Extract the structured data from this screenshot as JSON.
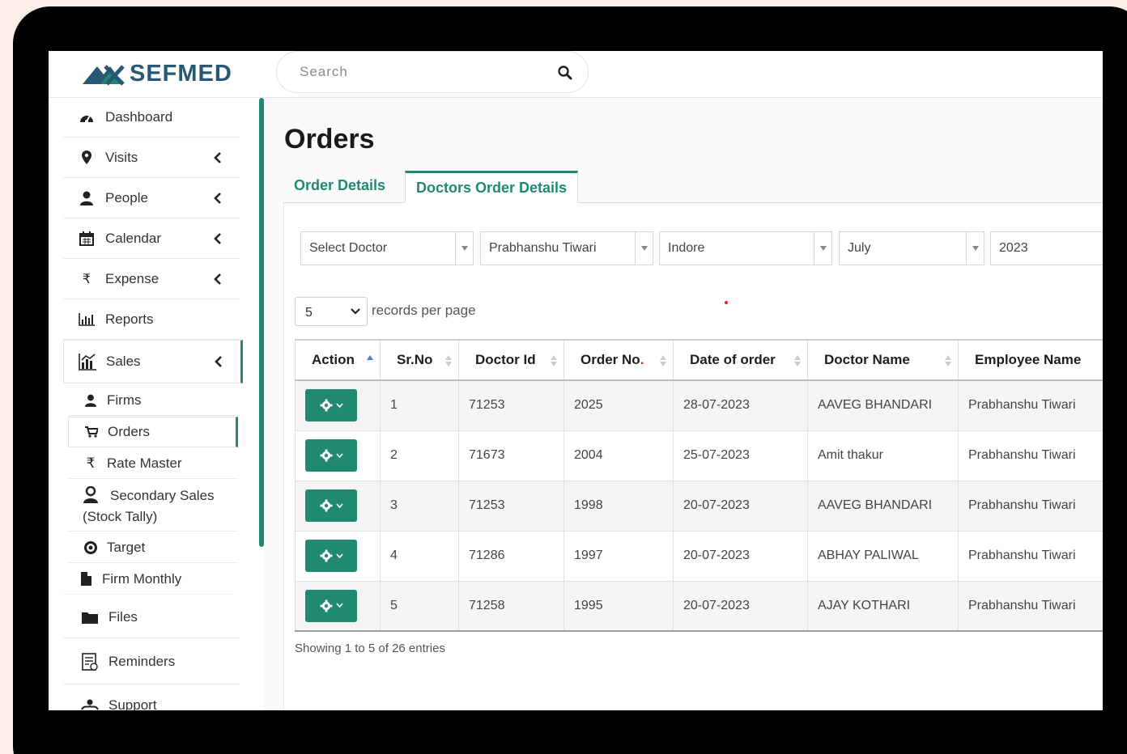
{
  "brand": {
    "name": "SEFMED",
    "accent": "#1f8a70",
    "logo_color": "#2a5874"
  },
  "search": {
    "placeholder": "Search"
  },
  "sidebar": {
    "items": [
      {
        "label": "Dashboard",
        "icon": "dashboard-icon",
        "expandable": false
      },
      {
        "label": "Visits",
        "icon": "map-marker-icon",
        "expandable": true
      },
      {
        "label": "People",
        "icon": "user-icon",
        "expandable": true
      },
      {
        "label": "Calendar",
        "icon": "calendar-icon",
        "expandable": true
      },
      {
        "label": "Expense",
        "icon": "rupee-icon",
        "expandable": true
      },
      {
        "label": "Reports",
        "icon": "bar-chart-icon",
        "expandable": false
      },
      {
        "label": "Sales",
        "icon": "sales-chart-icon",
        "expandable": true
      }
    ],
    "sales_sub": [
      {
        "label": "Firms",
        "icon": "user-icon"
      },
      {
        "label": "Orders",
        "icon": "cart-icon"
      },
      {
        "label": "Rate Master",
        "icon": "rupee-icon"
      },
      {
        "label": "Secondary Sales",
        "label2": "(Stock Tally)",
        "icon": "people-icon"
      },
      {
        "label": "Target",
        "icon": "target-icon"
      },
      {
        "label": "Firm Monthly",
        "icon": "file-icon"
      }
    ],
    "bottom": [
      {
        "label": "Files",
        "icon": "folder-icon"
      },
      {
        "label": "Reminders",
        "icon": "reminder-icon"
      },
      {
        "label": "Support",
        "icon": "support-icon"
      }
    ]
  },
  "page": {
    "title": "Orders",
    "tabs": [
      {
        "label": "Order Details",
        "active": false
      },
      {
        "label": "Doctors Order Details",
        "active": true
      }
    ]
  },
  "filters": {
    "doctor": "Select Doctor",
    "employee": "Prabhanshu Tiwari",
    "city": "Indore",
    "month": "July",
    "year": "2023"
  },
  "records_per_page": {
    "value": "5",
    "label": "records per page"
  },
  "table": {
    "columns": [
      "Action",
      "Sr.No",
      "Doctor Id",
      "Order No",
      "Date of order",
      "Doctor Name",
      "Employee Name"
    ],
    "rows": [
      {
        "sr": "1",
        "doctor_id": "71253",
        "order_no": "2025",
        "date": "28-07-2023",
        "doctor": "AAVEG BHANDARI",
        "employee": "Prabhanshu Tiwari"
      },
      {
        "sr": "2",
        "doctor_id": "71673",
        "order_no": "2004",
        "date": "25-07-2023",
        "doctor": "Amit thakur",
        "employee": "Prabhanshu Tiwari"
      },
      {
        "sr": "3",
        "doctor_id": "71253",
        "order_no": "1998",
        "date": "20-07-2023",
        "doctor": "AAVEG BHANDARI",
        "employee": "Prabhanshu Tiwari"
      },
      {
        "sr": "4",
        "doctor_id": "71286",
        "order_no": "1997",
        "date": "20-07-2023",
        "doctor": "ABHAY PALIWAL",
        "employee": "Prabhanshu Tiwari"
      },
      {
        "sr": "5",
        "doctor_id": "71258",
        "order_no": "1995",
        "date": "20-07-2023",
        "doctor": "AJAY KOTHARI",
        "employee": "Prabhanshu Tiwari"
      }
    ]
  },
  "footer": {
    "showing": "Showing 1 to 5 of 26 entries"
  }
}
